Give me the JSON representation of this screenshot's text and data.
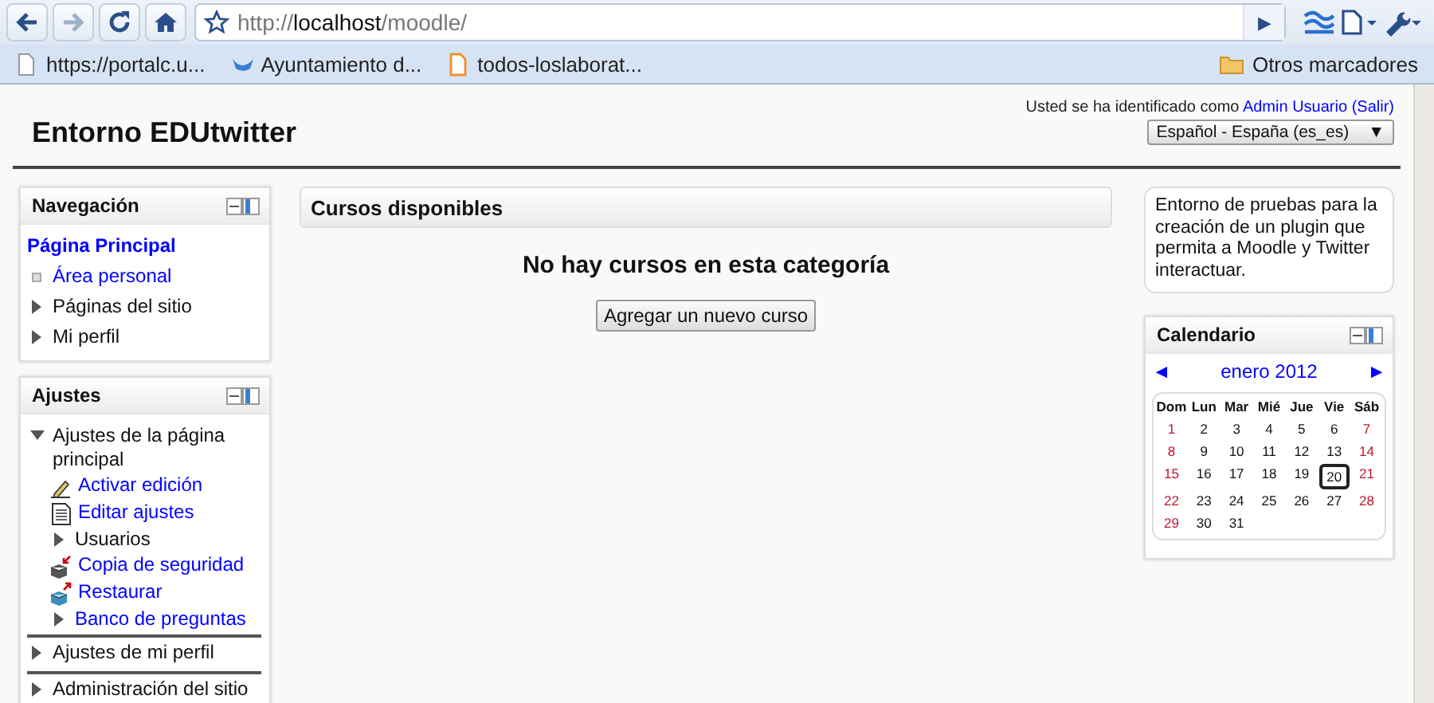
{
  "browser": {
    "url": {
      "scheme": "http://",
      "host": "localhost",
      "path": "/moodle/"
    },
    "go": "▶",
    "bookmarks": [
      {
        "label": "https://portalc.u..."
      },
      {
        "label": "Ayuntamiento d..."
      },
      {
        "label": "todos-loslaborat..."
      }
    ],
    "other_bookmarks": "Otros marcadores"
  },
  "header": {
    "site_title": "Entorno EDUtwitter",
    "login_prefix": "Usted se ha identificado como",
    "user": "Admin Usuario",
    "logout": "(Salir)",
    "language": "Español - España (es_es)",
    "language_caret": "▼"
  },
  "blocks_left": [
    {
      "kind": "navigation",
      "title": "Navegación",
      "items": [
        {
          "kind": "home",
          "label": "Página Principal"
        },
        {
          "kind": "leaf",
          "label": "Área personal"
        },
        {
          "kind": "branch",
          "label": "Páginas del sitio",
          "expanded": false
        },
        {
          "kind": "branch",
          "label": "Mi perfil",
          "expanded": false
        }
      ]
    },
    {
      "kind": "settings",
      "title": "Ajustes",
      "items": [
        {
          "kind": "branch",
          "label": "Ajustes de la página principal",
          "expanded": true,
          "children": [
            {
              "kind": "edit",
              "label": "Activar edición"
            },
            {
              "kind": "settings",
              "label": "Editar ajustes"
            },
            {
              "kind": "branch",
              "label": "Usuarios",
              "expanded": false
            },
            {
              "kind": "backup",
              "label": "Copia de seguridad"
            },
            {
              "kind": "restore",
              "label": "Restaurar"
            },
            {
              "kind": "linkbranch",
              "label": "Banco de preguntas",
              "expanded": false
            }
          ]
        },
        {
          "kind": "branch",
          "label": "Ajustes de mi perfil",
          "expanded": false
        },
        {
          "kind": "branch",
          "label": "Administración del sitio",
          "expanded": false
        }
      ]
    }
  ],
  "courses": {
    "heading": "Cursos disponibles",
    "message": "No hay cursos en esta categoría",
    "add_button": "Agregar un nuevo curso"
  },
  "description": "Entorno de pruebas para la creación de un plugin que permita a Moodle y Twitter interactuar.",
  "calendar": {
    "title": "Calendario",
    "prev": "◄",
    "month": "enero 2012",
    "next": "►",
    "weekdays": [
      "Dom",
      "Lun",
      "Mar",
      "Mié",
      "Jue",
      "Vie",
      "Sáb"
    ],
    "weeks": [
      [
        {
          "day": "1",
          "weekend": true,
          "today": false
        },
        {
          "day": "2",
          "weekend": false,
          "today": false
        },
        {
          "day": "3",
          "weekend": false,
          "today": false
        },
        {
          "day": "4",
          "weekend": false,
          "today": false
        },
        {
          "day": "5",
          "weekend": false,
          "today": false
        },
        {
          "day": "6",
          "weekend": false,
          "today": false
        },
        {
          "day": "7",
          "weekend": true,
          "today": false
        }
      ],
      [
        {
          "day": "8",
          "weekend": true,
          "today": false
        },
        {
          "day": "9",
          "weekend": false,
          "today": false
        },
        {
          "day": "10",
          "weekend": false,
          "today": false
        },
        {
          "day": "11",
          "weekend": false,
          "today": false
        },
        {
          "day": "12",
          "weekend": false,
          "today": false
        },
        {
          "day": "13",
          "weekend": false,
          "today": false
        },
        {
          "day": "14",
          "weekend": true,
          "today": false
        }
      ],
      [
        {
          "day": "15",
          "weekend": true,
          "today": false
        },
        {
          "day": "16",
          "weekend": false,
          "today": false
        },
        {
          "day": "17",
          "weekend": false,
          "today": false
        },
        {
          "day": "18",
          "weekend": false,
          "today": false
        },
        {
          "day": "19",
          "weekend": false,
          "today": false
        },
        {
          "day": "20",
          "weekend": false,
          "today": true
        },
        {
          "day": "21",
          "weekend": true,
          "today": false
        }
      ],
      [
        {
          "day": "22",
          "weekend": true,
          "today": false
        },
        {
          "day": "23",
          "weekend": false,
          "today": false
        },
        {
          "day": "24",
          "weekend": false,
          "today": false
        },
        {
          "day": "25",
          "weekend": false,
          "today": false
        },
        {
          "day": "26",
          "weekend": false,
          "today": false
        },
        {
          "day": "27",
          "weekend": false,
          "today": false
        },
        {
          "day": "28",
          "weekend": true,
          "today": false
        }
      ],
      [
        {
          "day": "29",
          "weekend": true,
          "today": false
        },
        {
          "day": "30",
          "weekend": false,
          "today": false
        },
        {
          "day": "31",
          "weekend": false,
          "today": false
        }
      ]
    ]
  }
}
